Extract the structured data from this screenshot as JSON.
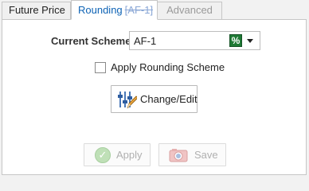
{
  "tabs": [
    {
      "label": "Future Price",
      "active": false
    },
    {
      "label": "Rounding",
      "suffix": "[AF-1]",
      "active": true
    },
    {
      "label": "Advanced",
      "active": false,
      "disabled": true
    }
  ],
  "scheme": {
    "label": "Current Scheme:",
    "value": "AF-1",
    "icon": "percent-icon",
    "icon_glyph": "%"
  },
  "apply_rounding": {
    "label": "Apply Rounding Scheme",
    "checked": false
  },
  "buttons": {
    "change_edit": "Change/Edit",
    "apply": "Apply",
    "save": "Save"
  },
  "colors": {
    "active_tab_text": "#0e63b5",
    "percent_icon_bg": "#1f7a35",
    "disabled_text": "#b0b0b0"
  }
}
